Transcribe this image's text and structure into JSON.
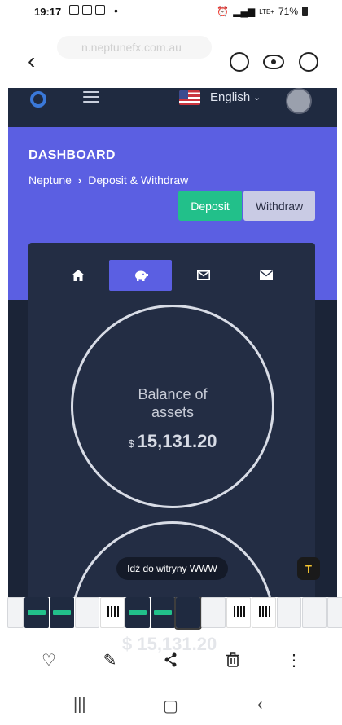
{
  "status_bar": {
    "time": "19:17",
    "network": "LTE+",
    "battery": "71%"
  },
  "viewer": {
    "url_ghost": "n.neptunefx.com.au"
  },
  "site_nav": {
    "language": "English"
  },
  "dashboard": {
    "title": "DASHBOARD",
    "breadcrumb_root": "Neptune",
    "breadcrumb_current": "Deposit & Withdraw",
    "deposit_label": "Deposit",
    "withdraw_label": "Withdraw"
  },
  "tabs": [
    {
      "icon": "home-icon"
    },
    {
      "icon": "piggy-bank-icon",
      "active": true
    },
    {
      "icon": "envelope-open-icon"
    },
    {
      "icon": "envelope-icon"
    }
  ],
  "balance": {
    "label": "Balance of\nassets",
    "currency": "$",
    "amount": "15,131.20"
  },
  "overlay": {
    "tooltip": "Idź do witryny WWW",
    "ghost_amount": "$ 15,131.20"
  },
  "colors": {
    "accent": "#5b5fe2",
    "deposit_green": "#22c08a",
    "withdraw_bg": "#c9cbe4",
    "page_dark": "#1b2437",
    "card_dark": "#232d44"
  }
}
